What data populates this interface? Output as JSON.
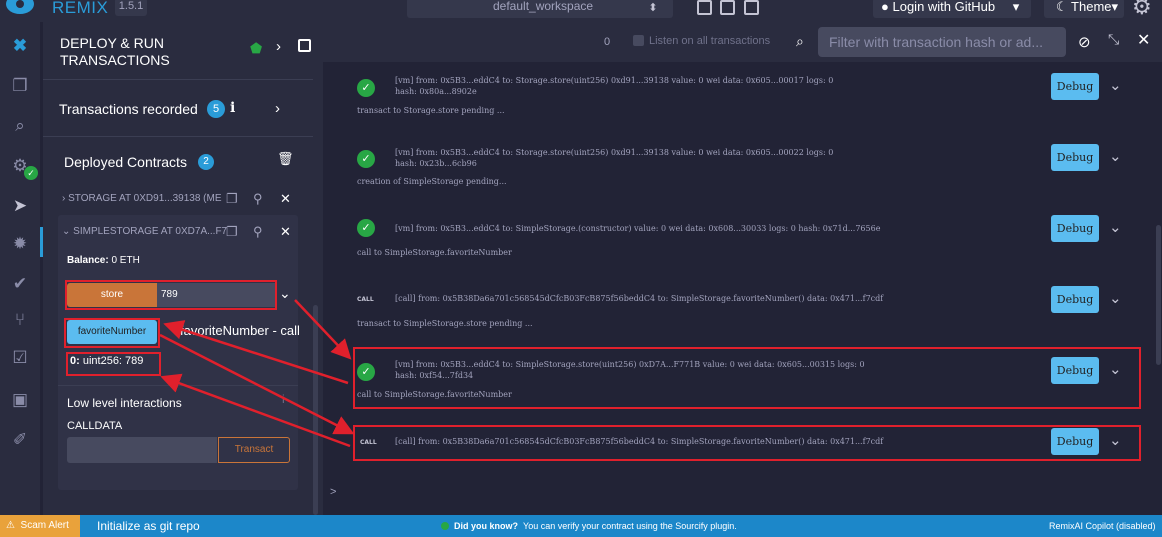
{
  "topbar": {
    "brand": "REMIX",
    "version": "1.5.1",
    "workspace": "default_workspace",
    "login_label": "Login with GitHub",
    "theme_label": "Theme"
  },
  "left_panel": {
    "title": "DEPLOY & RUN TRANSACTIONS",
    "transactions_recorded_label": "Transactions recorded",
    "transactions_recorded_count": "5",
    "deployed_contracts_label": "Deployed Contracts",
    "deployed_contracts_count": "2",
    "contracts": [
      {
        "label": "STORAGE AT 0XD91...39138 (ME"
      },
      {
        "label": "SIMPLESTORAGE AT 0XD7A...F7"
      }
    ],
    "balance_label": "Balance:",
    "balance_value": "0 ETH",
    "store_button": "store",
    "store_value": "789",
    "favorite_button": "favoriteNumber",
    "favorite_call_label": "favoriteNumber - call",
    "output_index": "0:",
    "output_value": "uint256: 789",
    "low_level_label": "Low level interactions",
    "calldata_label": "CALLDATA",
    "transact_button": "Transact"
  },
  "terminal": {
    "count": "0",
    "listen_label": "Listen on all transactions",
    "filter_placeholder": "Filter with transaction hash or ad...",
    "debug_label": "Debug",
    "entries": [
      {
        "line1": "[vm] from: 0x5B3...eddC4 to: Storage.store(uint256) 0xd91...39138 value: 0 wei data: 0x605...00017 logs: 0",
        "line2": "hash: 0x80a...8902e",
        "note": "transact to Storage.store pending ..."
      },
      {
        "line1": "[vm] from: 0x5B3...eddC4 to: Storage.store(uint256) 0xd91...39138 value: 0 wei data: 0x605...00022 logs: 0",
        "line2": "hash: 0x23b...6cb96",
        "note": "creation of SimpleStorage pending..."
      },
      {
        "line1": "[vm] from: 0x5B3...eddC4 to: SimpleStorage.(constructor) value: 0 wei data: 0x608...30033 logs: 0 hash: 0x71d...7656e",
        "line2": "",
        "note": "call to SimpleStorage.favoriteNumber"
      },
      {
        "line1": "[call] from: 0x5B38Da6a701c568545dCfcB03FcB875f56beddC4 to: SimpleStorage.favoriteNumber() data: 0x471...f7cdf",
        "line2": "",
        "note": "transact to SimpleStorage.store pending ..."
      },
      {
        "line1": "[vm] from: 0x5B3...eddC4 to: SimpleStorage.store(uint256) 0xD7A...F771B value: 0 wei data: 0x605...00315 logs: 0",
        "line2": "hash: 0xf54...7fd34",
        "note": "call to SimpleStorage.favoriteNumber"
      },
      {
        "line1": "[call] from: 0x5B38Da6a701c568545dCfcB03FcB875f56beddC4 to: SimpleStorage.favoriteNumber() data: 0x471...f7cdf",
        "line2": "",
        "note": ""
      }
    ],
    "call_tag": "CALL",
    "prompt": ">"
  },
  "status_bar": {
    "scam_alert": "Scam Alert",
    "git_label": "Initialize as git repo",
    "tip_bold": "Did you know?",
    "tip_text": "You can verify your contract using the Sourcify plugin.",
    "copilot": "RemixAI Copilot (disabled)"
  },
  "colors": {
    "accent": "#2a9cd8",
    "success": "#28a745",
    "store_orange": "#c97539",
    "annotation_red": "#e0202c",
    "status_blue": "#1c87c9"
  }
}
